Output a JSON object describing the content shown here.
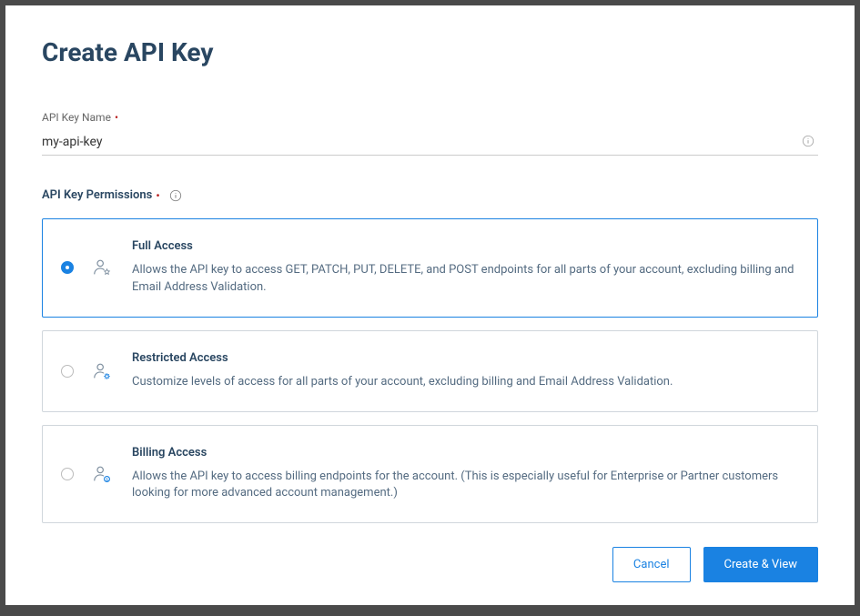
{
  "modal": {
    "title": "Create API Key"
  },
  "nameField": {
    "label": "API Key Name",
    "value": "my-api-key"
  },
  "permissions": {
    "label": "API Key Permissions",
    "options": [
      {
        "title": "Full Access",
        "description": "Allows the API key to access GET, PATCH, PUT, DELETE, and POST endpoints for all parts of your account, excluding billing and Email Address Validation.",
        "selected": true
      },
      {
        "title": "Restricted Access",
        "description": "Customize levels of access for all parts of your account, excluding billing and Email Address Validation.",
        "selected": false
      },
      {
        "title": "Billing Access",
        "description": "Allows the API key to access billing endpoints for the account. (This is especially useful for Enterprise or Partner customers looking for more advanced account management.)",
        "selected": false
      }
    ]
  },
  "buttons": {
    "cancel": "Cancel",
    "submit": "Create & View"
  }
}
